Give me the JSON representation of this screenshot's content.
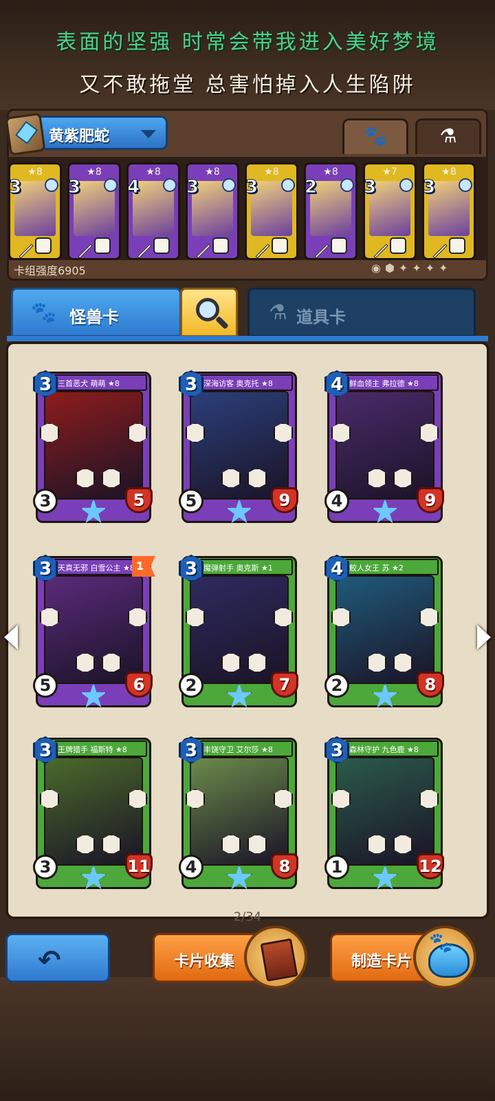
{
  "lyrics": {
    "line1": "表面的坚强 时常会带我进入美好梦境",
    "line2": "又不敢拖堂 总害怕掉入人生陷阱"
  },
  "deck": {
    "name": "黄紫肥蛇",
    "power_label": "卡组强度6905",
    "tab_icons": [
      "paw-icon",
      "potion-icon"
    ],
    "cards": [
      {
        "stars": "★8",
        "cost": "3",
        "color": "#e0b821"
      },
      {
        "stars": "★8",
        "cost": "3",
        "color": "#7a3fb8"
      },
      {
        "stars": "★8",
        "cost": "4",
        "color": "#7a3fb8"
      },
      {
        "stars": "★8",
        "cost": "3",
        "color": "#7a3fb8"
      },
      {
        "stars": "★8",
        "cost": "3",
        "color": "#e0b821"
      },
      {
        "stars": "★8",
        "cost": "2",
        "color": "#7a3fb8"
      },
      {
        "stars": "★7",
        "cost": "3",
        "color": "#e0b821"
      },
      {
        "stars": "★8",
        "cost": "3",
        "color": "#e0b821"
      }
    ]
  },
  "tabs": {
    "monster": "怪兽卡",
    "item": "道具卡"
  },
  "cards": [
    {
      "title": "三首恶犬 萌萌 ★8",
      "cost": "3",
      "attack": "3",
      "hp": "5",
      "color": "#7a3fb8",
      "art": "#8d1c1c",
      "flag": ""
    },
    {
      "title": "深海访客 奥克托 ★8",
      "cost": "3",
      "attack": "5",
      "hp": "9",
      "color": "#7a3fb8",
      "art": "#2b3f7a",
      "flag": ""
    },
    {
      "title": "鲜血领主 弗拉德 ★8",
      "cost": "4",
      "attack": "4",
      "hp": "9",
      "color": "#7a3fb8",
      "art": "#4a2a6a",
      "flag": ""
    },
    {
      "title": "天真无邪 白雪公主 ★8",
      "cost": "3",
      "attack": "5",
      "hp": "6",
      "color": "#7a3fb8",
      "art": "#5a2a7a",
      "flag": "1"
    },
    {
      "title": "魔弹射手 奥克斯 ★1",
      "cost": "3",
      "attack": "2",
      "hp": "7",
      "color": "#4ca83a",
      "art": "#2e2a5e",
      "flag": ""
    },
    {
      "title": "鲛人女王 苏 ★2",
      "cost": "4",
      "attack": "2",
      "hp": "8",
      "color": "#4ca83a",
      "art": "#1f5a7a",
      "flag": ""
    },
    {
      "title": "王牌猎手 福斯特 ★8",
      "cost": "3",
      "attack": "3",
      "hp": "11",
      "color": "#4ca83a",
      "art": "#4a6a2a",
      "flag": ""
    },
    {
      "title": "丰饶守卫 艾尔莎 ★8",
      "cost": "3",
      "attack": "4",
      "hp": "8",
      "color": "#4ca83a",
      "art": "#6a8a4a",
      "flag": ""
    },
    {
      "title": "森林守护 九色鹿 ★8",
      "cost": "3",
      "attack": "1",
      "hp": "12",
      "color": "#4ca83a",
      "art": "#2a5a4a",
      "flag": ""
    }
  ],
  "pager": "2/34",
  "buttons": {
    "collect": "卡片收集",
    "craft": "制造卡片"
  }
}
